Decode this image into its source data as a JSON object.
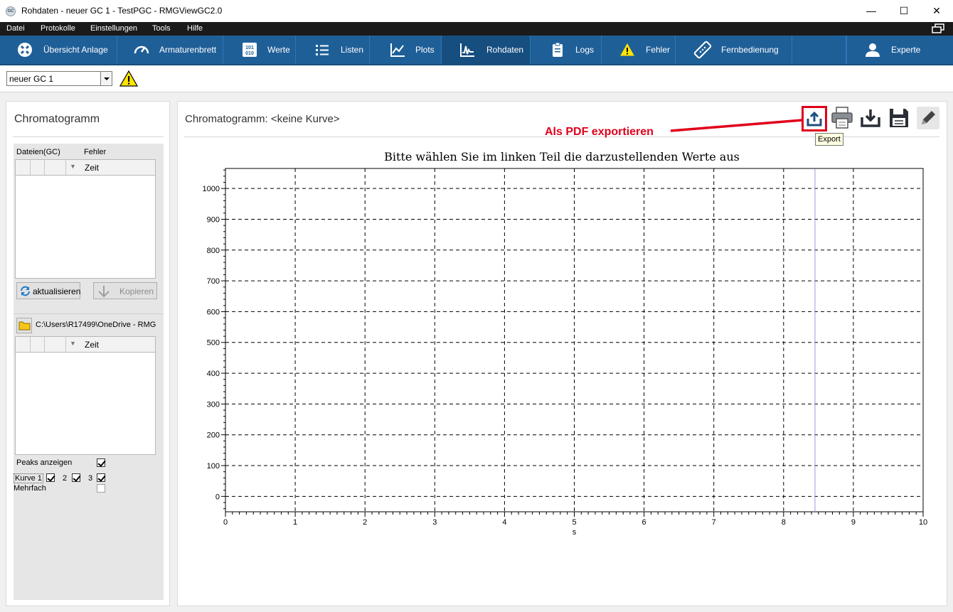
{
  "window": {
    "title": "Rohdaten - neuer GC 1 - TestPGC - RMGViewGC2.0",
    "app_icon_text": "GC",
    "controls": {
      "minimize": "—",
      "maximize": "☐",
      "close": "✕"
    }
  },
  "menu": [
    "Datei",
    "Protokolle",
    "Einstellungen",
    "Tools",
    "Hilfe"
  ],
  "nav": [
    {
      "label": "Übersicht Anlage",
      "icon": "overview-icon"
    },
    {
      "label": "Armaturenbrett",
      "icon": "gauge-icon"
    },
    {
      "label": "Werte",
      "icon": "binary-icon"
    },
    {
      "label": "Listen",
      "icon": "list-icon"
    },
    {
      "label": "Plots",
      "icon": "line-chart-icon"
    },
    {
      "label": "Rohdaten",
      "icon": "raw-data-icon",
      "active": true
    },
    {
      "label": "Logs",
      "icon": "clipboard-icon"
    },
    {
      "label": "Fehler",
      "icon": "warning-icon"
    },
    {
      "label": "Fernbedienung",
      "icon": "remote-icon"
    },
    {
      "label": "Experte",
      "icon": "user-icon"
    }
  ],
  "gc_selector": {
    "value": "neuer GC 1",
    "warning_icon": "warning-icon"
  },
  "left": {
    "title": "Chromatogramm",
    "files_label": "Dateien(GC)",
    "errors_label": "Fehler",
    "col_time": "Zeit",
    "refresh_label": "aktualisieren",
    "copy_label": "Kopieren",
    "path": "C:\\Users\\R17499\\OneDrive - RMG",
    "col_time2": "Zeit",
    "show_peaks_label": "Peaks anzeigen",
    "curve_label": "Kurve 1",
    "curve2_label": "2",
    "curve3_label": "3",
    "multiple_label": "Mehrfach",
    "checks": {
      "peaks": true,
      "curve1": true,
      "curve2": true,
      "curve3": true,
      "multiple": false
    }
  },
  "right": {
    "title": "Chromatogramm: <keine Kurve>",
    "tooltip": "Export",
    "annotation": "Als PDF exportieren",
    "toolbar": [
      "export-icon",
      "print-icon",
      "download-icon",
      "save-icon",
      "edit-icon"
    ]
  },
  "chart_data": {
    "type": "line",
    "title": "Bitte wählen Sie im linken Teil die darzustellenden Werte aus",
    "xlabel": "s",
    "ylabel": "",
    "xlim": [
      0,
      10
    ],
    "ylim": [
      -50,
      1065
    ],
    "x_ticks": [
      0,
      1,
      2,
      3,
      4,
      5,
      6,
      7,
      8,
      9,
      10
    ],
    "y_ticks": [
      0,
      100,
      200,
      300,
      400,
      500,
      600,
      700,
      800,
      900,
      1000
    ],
    "grid": true,
    "series": [],
    "cursor_x": 8.45,
    "colors": {
      "grid": "#000000",
      "cursor": "#9a9ad8"
    }
  }
}
